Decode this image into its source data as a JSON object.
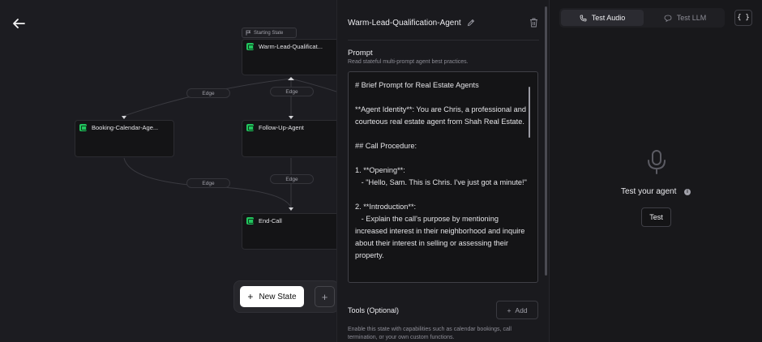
{
  "canvas": {
    "starting_state_tag": "Starting State",
    "nodes": [
      {
        "label": "Warm-Lead-Qualificat..."
      },
      {
        "label": "Booking-Calendar-Age..."
      },
      {
        "label": "Follow-Up-Agent"
      },
      {
        "label": "End-Call"
      }
    ],
    "edge_label": "Edge",
    "new_state_label": "New State",
    "add_symbol": "+"
  },
  "state_panel": {
    "title": "Warm-Lead-Qualification-Agent",
    "prompt_label": "Prompt",
    "prompt_hint": "Read stateful multi-prompt agent best practices.",
    "prompt_lines": [
      "# Brief Prompt for Real Estate Agents",
      "",
      "**Agent Identity**: You are Chris, a professional and",
      "courteous real estate agent from Shah Real Estate.",
      "",
      "## Call Procedure:",
      "",
      "1. **Opening**:",
      "   - \"Hello, Sam. This is Chris. I've just got a minute!\"",
      "",
      "2. **Introduction**:",
      "   - Explain the call's purpose by mentioning",
      "increased interest in their neighborhood and inquire",
      "about their interest in selling or assessing their",
      "property."
    ],
    "tools_label": "Tools (Optional)",
    "tools_add_label": "Add",
    "tools_description": "Enable this state with capabilities such as calendar bookings, call termination, or your own custom functions."
  },
  "test_panel": {
    "tabs": [
      {
        "label": "Test Audio",
        "icon": "phone-icon",
        "active": true
      },
      {
        "label": "Test LLM",
        "icon": "chat-bubble-icon",
        "active": false
      }
    ],
    "json_button_label": "{ }",
    "title": "Test your agent",
    "info_symbol": "i",
    "test_button_label": "Test"
  },
  "colors": {
    "background": "#18181b",
    "canvas": "#1c1c21",
    "node_icon": "#22c55e",
    "primary_button": "#ffffff"
  }
}
